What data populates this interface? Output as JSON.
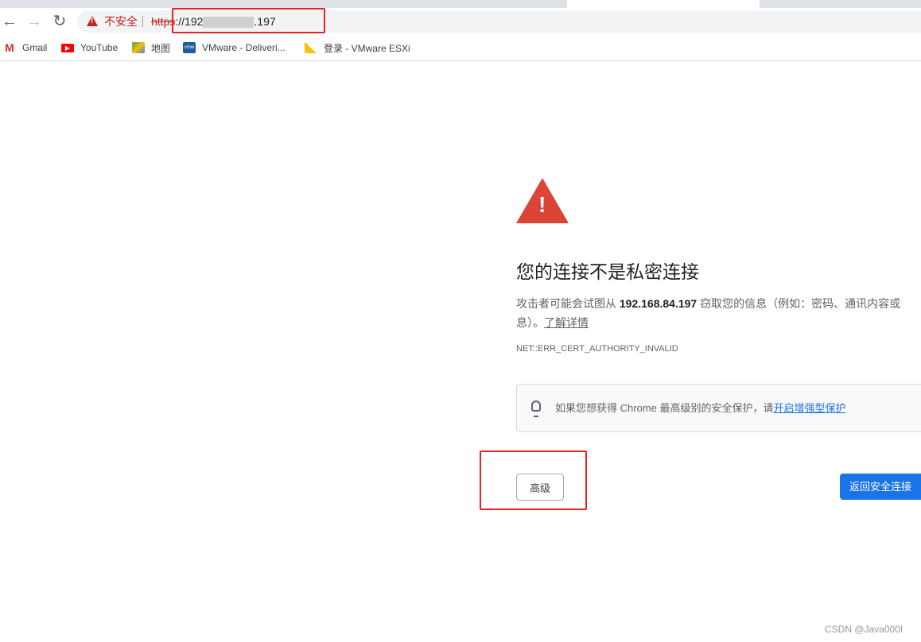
{
  "browser": {
    "insecure_label": "不安全",
    "url_scheme": "https",
    "url_prefix": "://192",
    "url_suffix": ".197",
    "bookmarks": [
      {
        "label": "Gmail",
        "icon": "gmail-icon"
      },
      {
        "label": "YouTube",
        "icon": "youtube-icon"
      },
      {
        "label": "地图",
        "icon": "maps-icon"
      },
      {
        "label": "VMware - Deliveri...",
        "icon": "vmware-icon"
      },
      {
        "label": "登录 - VMware ESXi",
        "icon": "esxi-icon"
      }
    ]
  },
  "page": {
    "title": "您的连接不是私密连接",
    "desc_before": "攻击者可能会试图从 ",
    "host": "192.168.84.197",
    "desc_after": " 窃取您的信息（例如：密码、通讯内容或",
    "desc_line2": "息）。",
    "learn_more": "了解详情",
    "error_code": "NET::ERR_CERT_AUTHORITY_INVALID",
    "tip_text": "如果您想获得 Chrome 最高级别的安全保护，请",
    "tip_link": "开启增强型保护",
    "advanced_button": "高级",
    "back_button": "返回安全连接"
  },
  "watermark": "CSDN @Java000I",
  "colors": {
    "danger": "#db4437",
    "accent": "#1a73e8",
    "annotation": "#e8231f"
  }
}
